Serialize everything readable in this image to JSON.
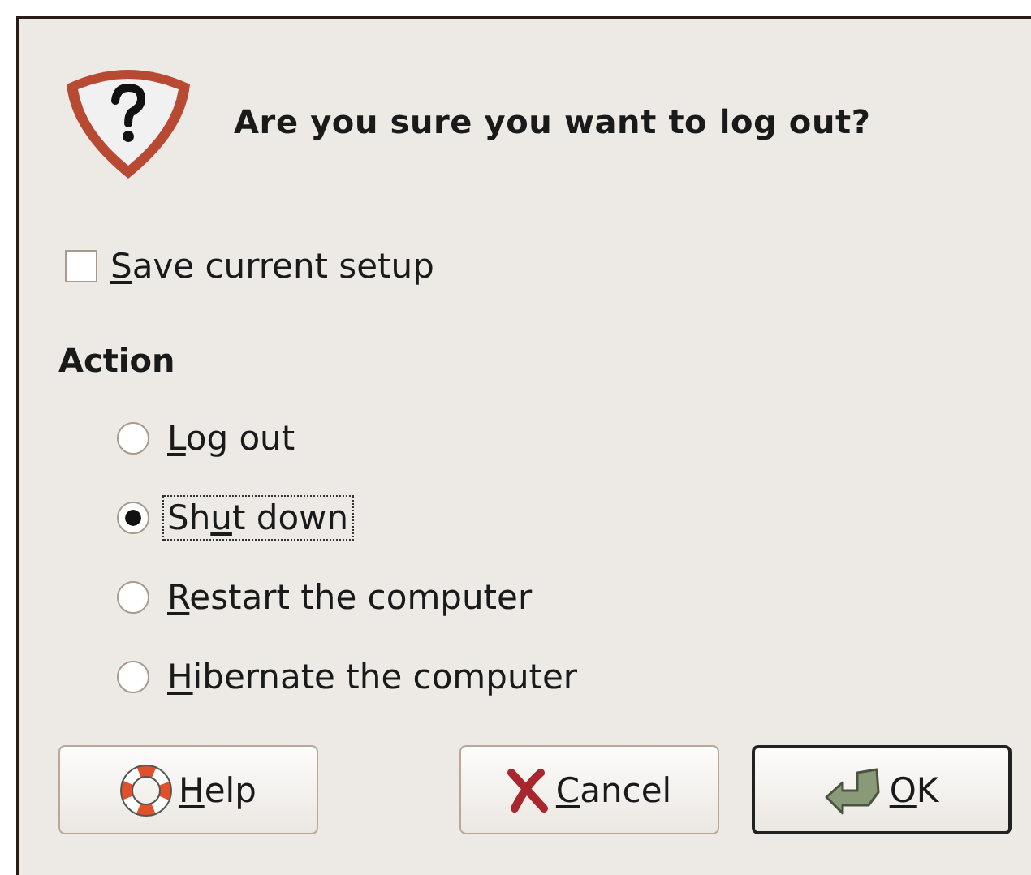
{
  "dialog": {
    "question": "Are you sure you want to log out?",
    "save_setup": {
      "key": "S",
      "post": "ave current setup",
      "checked": false
    },
    "action": {
      "heading": "Action",
      "options": [
        {
          "key": "L",
          "post": "og out",
          "selected": false,
          "focused": false
        },
        {
          "pre": "Sh",
          "key": "u",
          "post": "t down",
          "selected": true,
          "focused": true
        },
        {
          "key": "R",
          "post": "estart the computer",
          "selected": false,
          "focused": false
        },
        {
          "key": "H",
          "post": "ibernate the computer",
          "selected": false,
          "focused": false
        }
      ]
    },
    "buttons": [
      {
        "kind": "help",
        "key": "H",
        "post": "elp",
        "default": false
      },
      {
        "kind": "cancel",
        "key": "C",
        "post": "ancel",
        "default": false
      },
      {
        "kind": "ok",
        "key": "O",
        "post": "K",
        "default": true
      }
    ]
  }
}
